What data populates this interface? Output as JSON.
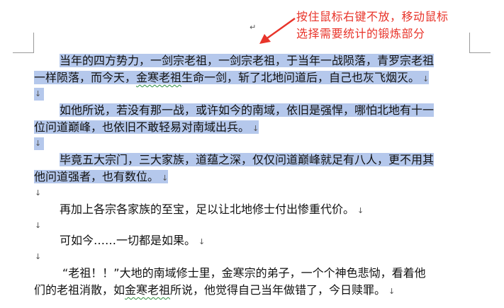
{
  "annotation": {
    "line1": "按住鼠标右键不放，移动鼠标",
    "line2": "选择需要统计的锻炼部分"
  },
  "marks": {
    "paragraph": "↓",
    "top": "↵"
  },
  "doc": {
    "p1_l1": "当年的四方势力，一剑宗老祖，一剑宗老祖，于当年一战陨落，青罗宗老祖",
    "p1_l2a": "一样陨落，而今天，",
    "p1_l2b": "金寒老祖",
    "p1_l2c": "生命一剑，斩了北地问道后，自己也灰飞烟灭。",
    "p2_l1": "如他所说，若没有那一战，或许如今的南域，依旧是强悍，哪怕北地有十一",
    "p2_l2": "位问道巅峰，也依旧不敢轻易对南域出兵。",
    "p3_l1": "毕竟五大宗门，三大家族，道蕴之深，仅仅问道巅峰就足有八人，更不用其",
    "p3_l2": "他问道强者，也有数位。",
    "p4_l1": "再加上各宗各家族的至宝，足以让北地修士付出惨重代价。",
    "p5_l1": "可如今……一切都是如果。",
    "p6_l1": "“老祖！！”大地的南域修士里，金寒宗的弟子，一个个神色悲恸，看着他",
    "p6_l2a": "们的老祖消散，如",
    "p6_l2b": "金寒老祖",
    "p6_l2c": "所说，他觉得自己当年做错了，今日赎罪。"
  }
}
